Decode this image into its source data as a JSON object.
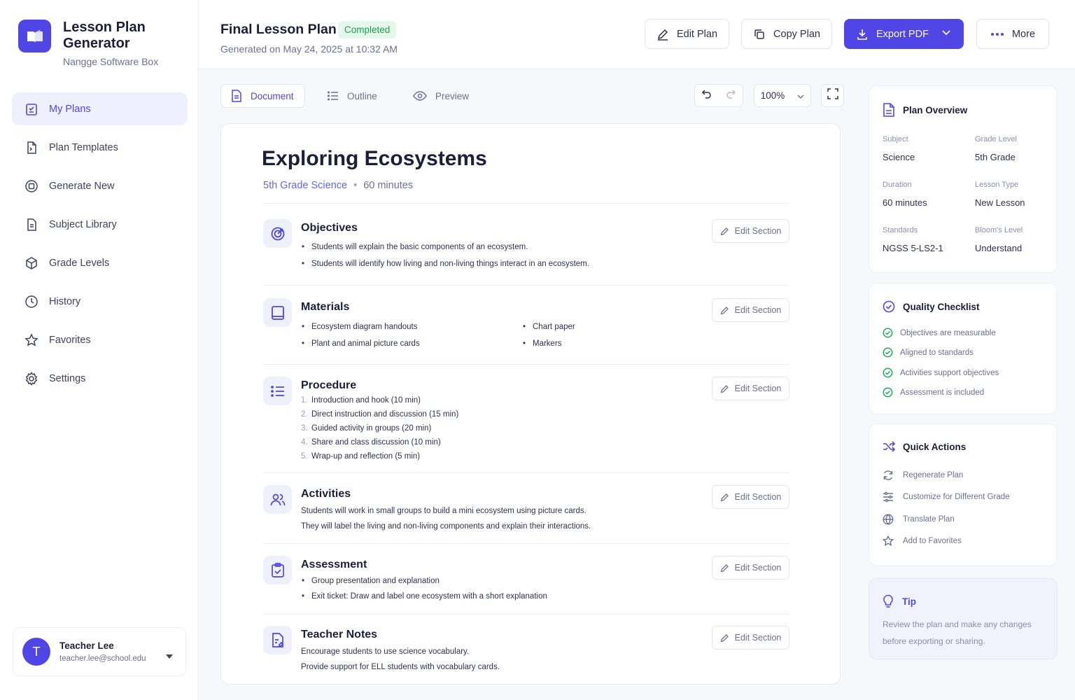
{
  "brand": {
    "title": "Lesson Plan Generator",
    "subtitle": "Nangge Software Box"
  },
  "nav": [
    {
      "label": "My Plans",
      "icon": "clipboard-icon",
      "active": true
    },
    {
      "label": "Plan Templates",
      "icon": "file-icon"
    },
    {
      "label": "Generate New",
      "icon": "plus-circle-icon"
    },
    {
      "label": "Subject Library",
      "icon": "document-icon"
    },
    {
      "label": "Grade Levels",
      "icon": "layers-icon"
    },
    {
      "label": "History",
      "icon": "clock-icon"
    },
    {
      "label": "Favorites",
      "icon": "star-icon"
    },
    {
      "label": "Settings",
      "icon": "gear-icon"
    }
  ],
  "user": {
    "initial": "T",
    "name": "Teacher Lee",
    "email": "teacher.lee@school.edu"
  },
  "header": {
    "title": "Final Lesson Plan",
    "status": "Completed",
    "subtitle": "Generated on May 24, 2025 at 10:32 AM",
    "edit_label": "Edit Plan",
    "copy_label": "Copy Plan",
    "export_label": "Export PDF",
    "more_label": "More"
  },
  "toolbar": {
    "tabs": [
      "Document",
      "Outline",
      "Preview"
    ],
    "zoom": "100%"
  },
  "doc": {
    "title": "Exploring Ecosystems",
    "grade": "5th Grade Science",
    "duration": "60 minutes",
    "edit_label": "Edit Section",
    "objectives": {
      "title": "Objectives",
      "items": [
        "Students will explain the basic components of an ecosystem.",
        "Students will identify how living and non-living things interact in an ecosystem."
      ]
    },
    "materials": {
      "title": "Materials",
      "items": [
        "Ecosystem diagram handouts",
        "Plant and animal picture cards",
        "Chart paper",
        "Markers"
      ]
    },
    "procedure": {
      "title": "Procedure",
      "items": [
        "Introduction and hook (10 min)",
        "Direct instruction and discussion (15 min)",
        "Guided activity in groups (20 min)",
        "Share and class discussion (10 min)",
        "Wrap-up and reflection (5 min)"
      ]
    },
    "activities": {
      "title": "Activities",
      "lines": [
        "Students will work in small groups to build a mini ecosystem using picture cards.",
        "They will label the living and non-living components and explain their interactions."
      ]
    },
    "assessment": {
      "title": "Assessment",
      "items": [
        "Group presentation and explanation",
        "Exit ticket: Draw and label one ecosystem with a short explanation"
      ]
    },
    "notes": {
      "title": "Teacher Notes",
      "lines": [
        "Encourage students to use science vocabulary.",
        "Provide support for ELL students with vocabulary cards."
      ]
    }
  },
  "overview": {
    "title": "Plan Overview",
    "fields": [
      {
        "label": "Subject",
        "value": "Science"
      },
      {
        "label": "Grade Level",
        "value": "5th Grade"
      },
      {
        "label": "Duration",
        "value": "60 minutes"
      },
      {
        "label": "Lesson Type",
        "value": "New Lesson"
      },
      {
        "label": "Standards",
        "value": "NGSS 5-LS2-1"
      },
      {
        "label": "Bloom's Level",
        "value": "Understand"
      }
    ]
  },
  "checklist": {
    "title": "Quality Checklist",
    "items": [
      "Objectives are measurable",
      "Aligned to standards",
      "Activities support objectives",
      "Assessment is included"
    ]
  },
  "quick_actions": {
    "title": "Quick Actions",
    "items": [
      "Regenerate Plan",
      "Customize for Different Grade",
      "Translate Plan",
      "Add to Favorites"
    ]
  },
  "tip": {
    "title": "Tip",
    "text": "Review the plan and make any changes before exporting or sharing."
  },
  "colors": {
    "accent": "#4f46e5",
    "success": "#1f9d55"
  }
}
